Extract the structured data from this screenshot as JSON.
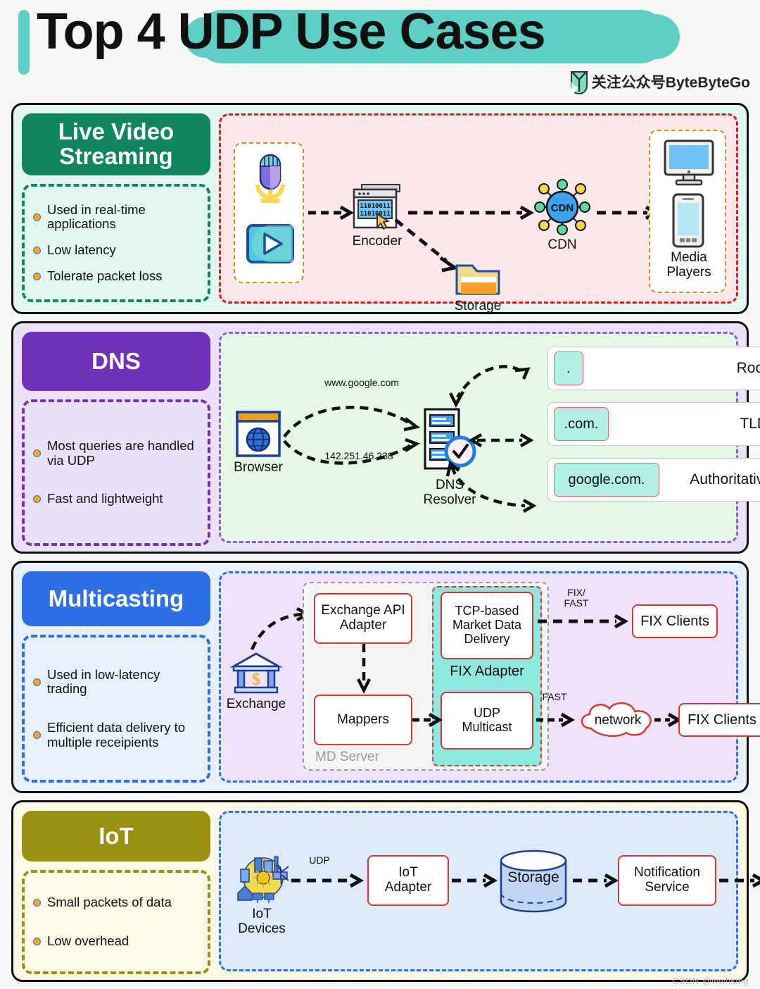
{
  "header": {
    "title_plain": "Top 4 ",
    "title_highlight": "UDP Use Cases",
    "brand_text": "关注公众号ByteByteGo",
    "brand_logo_icon": "bytebytego-logo-icon",
    "accent_color": "#5ecfc5"
  },
  "watermark": "CSDN @wwhking",
  "sections": [
    {
      "id": "live-video-streaming",
      "badge": "Live Video\nStreaming",
      "badge_color": "#11855f",
      "panel_color": "#e2f7ef",
      "diagram_color": "#fce7eb",
      "bullets": [
        "Used in real-time\napplications",
        "Low latency",
        "Tolerate packet loss"
      ],
      "diagram": {
        "source_group_label": "",
        "icons": [
          "microphone-icon",
          "video-play-icon"
        ],
        "encoder_label": "Encoder",
        "encoder_binary_line1": "11010011",
        "encoder_binary_line2": "11010011",
        "storage_label": "Storage",
        "cdn_node_label": "CDN",
        "cdn_label": "CDN",
        "media_players_label": "Media\nPlayers",
        "media_icons": [
          "monitor-icon",
          "smartphone-icon"
        ]
      }
    },
    {
      "id": "dns",
      "badge": "DNS",
      "badge_color": "#7131b8",
      "panel_color": "#ece1fa",
      "diagram_color": "#e5f7e5",
      "bullets": [
        "Most queries are\nhandled via UDP",
        "Fast and lightweight"
      ],
      "diagram": {
        "browser_label": "Browser",
        "query_label": "www.google.com",
        "answer_label": "142.251.46.238",
        "resolver_label": "DNS\nResolver",
        "servers": [
          {
            "chip": ".",
            "name": "Root"
          },
          {
            "chip": ".com.",
            "name": "TLD"
          },
          {
            "chip": "google.com.",
            "name": "Authoritative"
          }
        ]
      }
    },
    {
      "id": "multicasting",
      "badge": "Multicasting",
      "badge_color": "#2e6fe6",
      "panel_color": "#e7f1fd",
      "diagram_color": "#efe2fa",
      "bullets": [
        "Used in low-latency\ntrading",
        "Efficient data delivery\nto multiple receipients"
      ],
      "diagram": {
        "exchange_label": "Exchange",
        "md_server_label": "MD Server",
        "exchange_api_adapter": "Exchange API\nAdapter",
        "mappers": "Mappers",
        "fix_adapter_label": "FIX Adapter",
        "tcp_market_data": "TCP-based\nMarket Data\nDelivery",
        "udp_multicast": "UDP\nMulticast",
        "fix_fast_label": "FIX/\nFAST",
        "fast_label": "FAST",
        "network_label": "network",
        "fix_clients_top": "FIX Clients",
        "fix_clients_bottom": "FIX Clients"
      }
    },
    {
      "id": "iot",
      "badge": "IoT",
      "badge_color": "#9b8f14",
      "panel_color": "#fcfae6",
      "diagram_color": "#dceafb",
      "bullets": [
        "Small packets of data",
        "Low overhead"
      ],
      "diagram": {
        "devices_label": "IoT\nDevices",
        "protocol_label": "UDP",
        "iot_adapter": "IoT\nAdapter",
        "storage": "Storage",
        "notification_service": "Notification\nService",
        "mail_icon": "email-icon"
      }
    }
  ]
}
